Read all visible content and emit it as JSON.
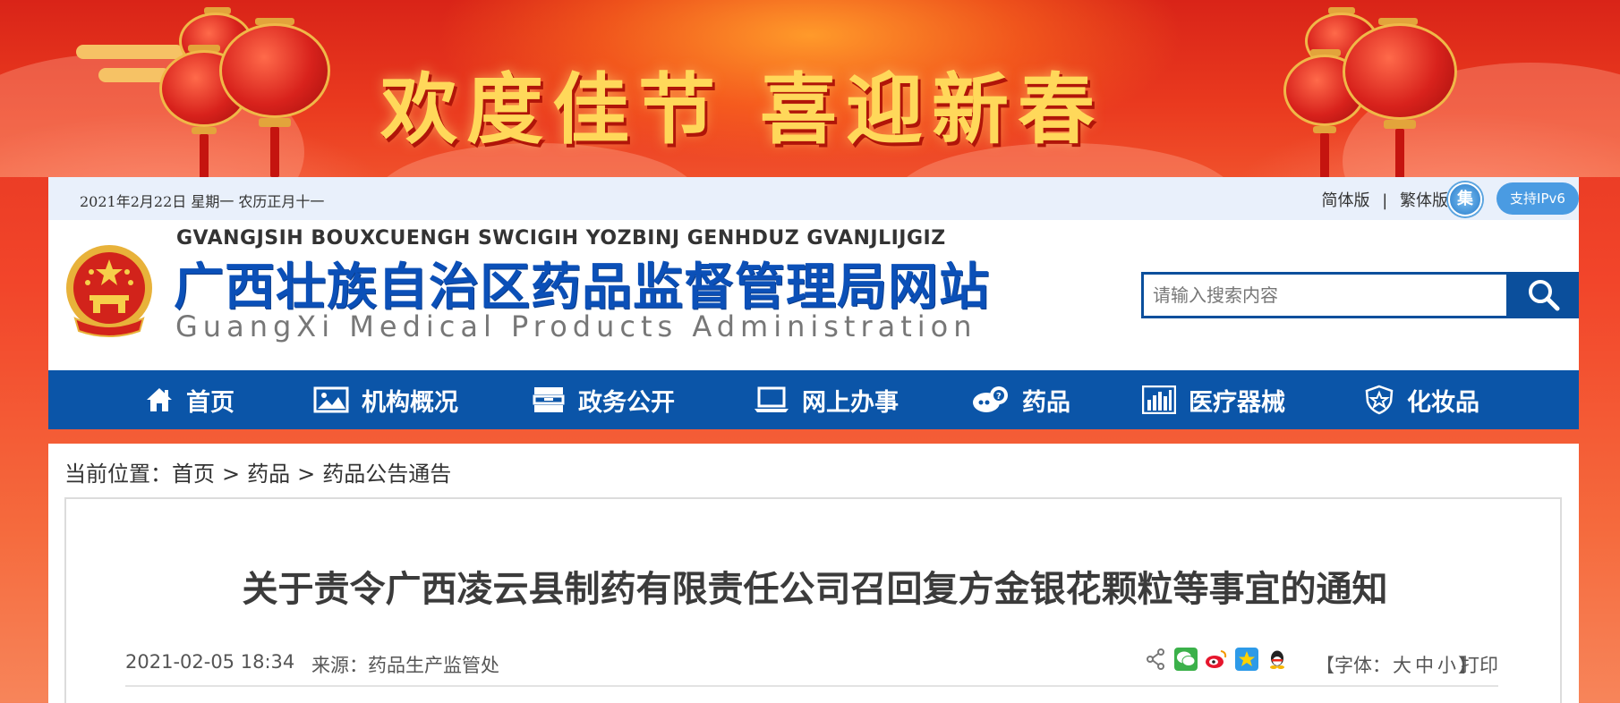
{
  "banner": {
    "slogan": "欢度佳节  喜迎新春"
  },
  "topbar": {
    "date": "2021年2月22日  星期一  农历正月十一",
    "simplified": "简体版",
    "separator": "|",
    "traditional": "繁体版",
    "ipv6_icon_char": "集",
    "ipv6_label": "支持IPv6"
  },
  "header": {
    "pinyin": "GVANGJSIH BOUXCUENGH SWCIGIH YOZBINJ GENHDUZ GVANJLIJGIZ",
    "site_name": "广西壮族自治区药品监督管理局网站",
    "english_name": "GuangXi  Medical  Products  Administration",
    "search_placeholder": "请输入搜索内容"
  },
  "nav": {
    "items": [
      {
        "label": "首页",
        "icon": "home-icon"
      },
      {
        "label": "机构概况",
        "icon": "picture-icon"
      },
      {
        "label": "政务公开",
        "icon": "cabinet-icon"
      },
      {
        "label": "网上办事",
        "icon": "laptop-icon"
      },
      {
        "label": "药品",
        "icon": "pill-chat-icon"
      },
      {
        "label": "医疗器械",
        "icon": "bar-chart-icon"
      },
      {
        "label": "化妆品",
        "icon": "shield-icon"
      }
    ]
  },
  "breadcrumb": {
    "prefix": "当前位置：",
    "items": [
      "首页",
      "药品",
      "药品公告通告"
    ],
    "sep": ">"
  },
  "article": {
    "title": "关于责令广西凌云县制药有限责任公司召回复方金银花颗粒等事宜的通知",
    "date": "2021-02-05 18:34",
    "source": "来源：药品生产监管处",
    "font_label_open": "【字体：",
    "font_large": "大",
    "font_medium": "中",
    "font_small": "小",
    "font_label_close": "】",
    "print": "打印"
  },
  "colors": {
    "nav_bg": "#0b55a8",
    "site_name": "#0b50b8",
    "banner_text": "#ffd85a"
  }
}
